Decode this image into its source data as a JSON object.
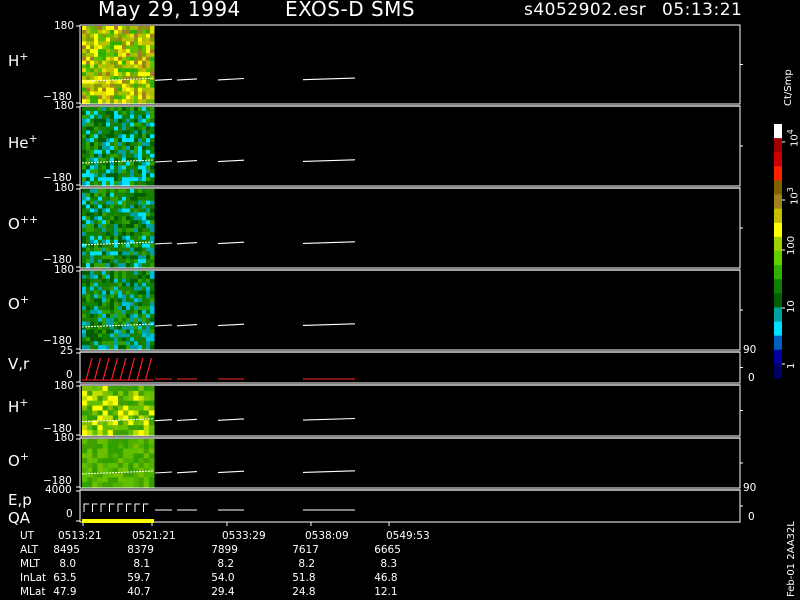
{
  "header": {
    "date": "May 29, 1994",
    "instrument": "EXOS-D SMS",
    "file": "s4052902.esr",
    "time": "05:13:21"
  },
  "panels": [
    {
      "label_base": "H",
      "label_sup": "+",
      "y_top": "180",
      "y_bot": "−180"
    },
    {
      "label_base": "He",
      "label_sup": "+",
      "y_top": "180",
      "y_bot": "−180"
    },
    {
      "label_base": "O",
      "label_sup": "++",
      "y_top": "180",
      "y_bot": "−180"
    },
    {
      "label_base": "O",
      "label_sup": "+",
      "y_top": "180",
      "y_bot": "−180"
    },
    {
      "label_base": "V,r",
      "label_sup": "",
      "y_top": "25",
      "y_bot": "0",
      "right_top": "90",
      "right_bot": "0"
    },
    {
      "label_base": "H",
      "label_sup": "+",
      "y_top": "180",
      "y_bot": "−180"
    },
    {
      "label_base": "O",
      "label_sup": "+",
      "y_top": "180",
      "y_bot": "−180"
    },
    {
      "label_base": "E,p",
      "label_sup": "",
      "label2": "QA",
      "y_top": "4000",
      "y_bot": "0",
      "right_top": "90",
      "right_bot": "0"
    }
  ],
  "colorbar": {
    "title": "Ct/Smp",
    "ticks": [
      {
        "base": "10",
        "sup": "4"
      },
      {
        "base": "10",
        "sup": "3"
      },
      {
        "base": "100",
        "sup": ""
      },
      {
        "base": "10",
        "sup": ""
      },
      {
        "base": "1",
        "sup": ""
      }
    ],
    "colors": [
      "#ffffff",
      "#a00000",
      "#cc0000",
      "#ff2000",
      "#806000",
      "#a08020",
      "#c0c000",
      "#ffff00",
      "#a0d000",
      "#60d000",
      "#30b000",
      "#108000",
      "#006000",
      "#00a0a0",
      "#00e0ff",
      "#0060c0",
      "#0000a0",
      "#000060"
    ]
  },
  "orbit": {
    "rows": [
      {
        "label": "UT",
        "values": [
          "0513:21",
          "0521:21",
          "0533:29",
          "0538:09",
          "0549:53"
        ]
      },
      {
        "label": "ALT",
        "values": [
          "8495",
          "8379",
          "7899",
          "7617",
          "6665"
        ]
      },
      {
        "label": "MLT",
        "values": [
          "8.0",
          "8.1",
          "8.2",
          "8.2",
          "8.3"
        ]
      },
      {
        "label": "InLat",
        "values": [
          "63.5",
          "59.7",
          "54.0",
          "51.8",
          "46.8"
        ]
      },
      {
        "label": "MLat",
        "values": [
          "47.9",
          "40.7",
          "29.4",
          "24.8",
          "12.1"
        ]
      }
    ]
  },
  "footer_id": "Feb-01 2AA32L",
  "chart_data": {
    "type": "heatmap",
    "title": "May 29, 1994   EXOS-D SMS",
    "x_ticks": [
      "0513:21",
      "0521:21",
      "0533:29",
      "0538:09",
      "0549:53"
    ],
    "species_panels": [
      "H+",
      "He+",
      "O++",
      "O+",
      "V,r",
      "H+",
      "O+",
      "E,p / QA"
    ],
    "ylim_angle": [
      -180,
      180
    ],
    "ylim_vr": [
      0,
      25
    ],
    "ylim_ep": [
      0,
      4000
    ],
    "colorbar_scale": "log",
    "colorbar_range": [
      1,
      10000
    ],
    "colorbar_label": "Ct/Smp"
  }
}
